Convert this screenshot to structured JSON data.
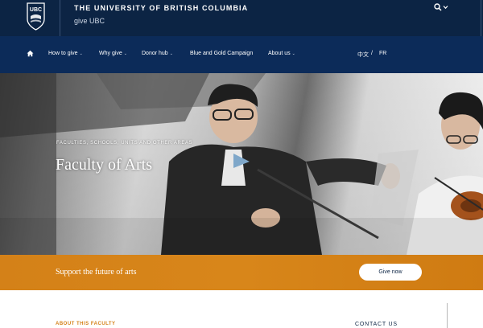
{
  "header": {
    "logo_text": "UBC",
    "university_name": "THE UNIVERSITY OF BRITISH COLUMBIA",
    "site_name": "give UBC",
    "search_icon": "search-icon",
    "chevron_icon": "chevron-down-icon",
    "colors": {
      "header_bg": "#0c2444",
      "nav_bg": "#0c2b59"
    }
  },
  "nav": {
    "home_icon": "home-icon",
    "items": [
      {
        "label": "How to give",
        "has_dropdown": true
      },
      {
        "label": "Why give",
        "has_dropdown": true
      },
      {
        "label": "Donor hub",
        "has_dropdown": true
      },
      {
        "label": "Blue and Gold Campaign",
        "has_dropdown": false
      },
      {
        "label": "About us",
        "has_dropdown": true
      }
    ],
    "languages": {
      "zh": "中文",
      "separator": "/",
      "fr": "FR"
    }
  },
  "hero": {
    "subtitle": "FACULTIES, SCHOOLS, UNITS AND OTHER AREAS",
    "title": "Faculty of Arts"
  },
  "banner": {
    "text": "Support the future of arts",
    "button_label": "Give now",
    "color": "#d48118"
  },
  "content": {
    "about_label": "ABOUT THIS FACULTY",
    "contact_label": "CONTACT US"
  }
}
